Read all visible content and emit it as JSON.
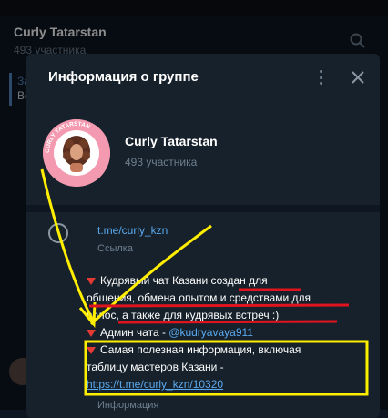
{
  "background_chat": {
    "title": "Curly Tatarstan",
    "subtitle": "493 участника",
    "pinned_label": "За",
    "pinned_text": "Во"
  },
  "dialog": {
    "title": "Информация о группе",
    "group_name": "Curly Tatarstan",
    "members": "493 участника",
    "avatar_text": "CURLY TATARSTAN",
    "link": "t.me/curly_kzn",
    "link_caption": "Ссылка",
    "description": {
      "line1": "Кудрявый чат Казани создан для",
      "line2": "общения, обмена опытом и средствами для",
      "line3": "волос, а также для кудрявых встреч :)",
      "admin_prefix": "Админ чата - ",
      "admin_handle": "@kudryavaya911",
      "line5": "Самая полезная информация, включая",
      "line6": "таблицу мастеров Казани -",
      "url": "https://t.me/curly_kzn/10320"
    },
    "description_caption": "Информация"
  },
  "colors": {
    "accent": "#5aaaf0",
    "annotation_yellow": "#ffee00",
    "annotation_red": "#e0141e",
    "bullet_red": "#e53935"
  },
  "icons": [
    "search-icon",
    "more-vert-icon",
    "close-icon",
    "info-icon",
    "red-triangle-icon"
  ]
}
